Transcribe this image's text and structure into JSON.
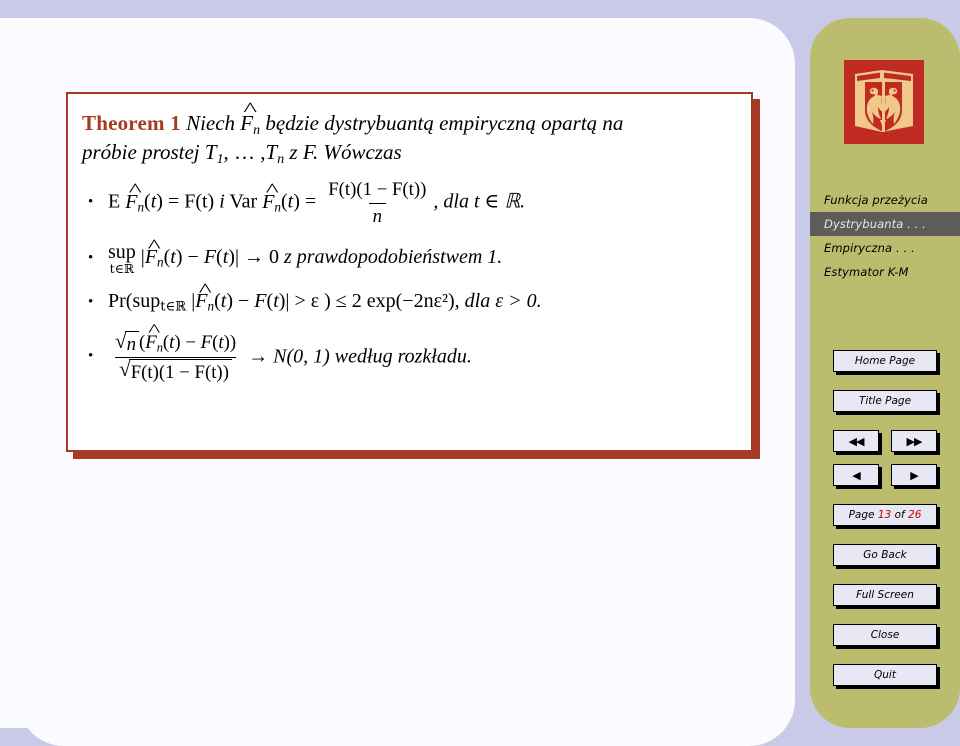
{
  "colors": {
    "background": "#c9c9e8",
    "slide_background": "#fbfaff",
    "theorem_border": "#a63a22",
    "theorem_label": "#a63a22",
    "nav_panel": "#bcbc6e",
    "nav_active": "#5c5c5c",
    "logo_red": "#bf2b21",
    "logo_tan": "#f0c88a",
    "button_face": "#e8e8f4",
    "page_number_red": "#c00000"
  },
  "slide": {
    "theorem": {
      "label": "Theorem 1",
      "statement_line1": "Niech",
      "statement_F": "F",
      "statement_n": "n",
      "statement_line1b": "będzie dystrybuantą empiryczną opartą na",
      "statement_line2a": "próbie prostej",
      "statement_T": "T",
      "statement_T1sub": "1",
      "statement_dots": ", … ,",
      "statement_Tn": "T",
      "statement_Tnsub": "n",
      "statement_line2b": "z",
      "statement_Fcap": "F.",
      "statement_line2c": "Wówczas",
      "bullets": [
        {
          "id": "bullet-expectation-variance",
          "text": "E F̂ₙ(t) = F(t) i Var F̂ₙ(t) = F(t)(1 − F(t)) / n, dla t ∈ ℝ.",
          "parts": {
            "E": "E",
            "eq_Ft": "= F(t)",
            "i": "i",
            "Var": "Var",
            "eq": "=",
            "numerator": "F(t)(1 − F(t))",
            "denominator": "n",
            "tail": ", dla t ∈ ℝ."
          }
        },
        {
          "id": "bullet-sup-convergence",
          "text": "sup_{t∈ℝ} |F̂ₙ(t) − F(t)| → 0 z prawdopodobieństwem 1.",
          "parts": {
            "sup": "sup",
            "sub": "t∈ℝ",
            "body": "| F̂ₙ(t) − F(t) |",
            "arrow": "→",
            "zero": "0",
            "tail": "z prawdopodobieństwem 1."
          }
        },
        {
          "id": "bullet-dkw-inequality",
          "text": "Pr( sup_{t∈ℝ} |F̂ₙ(t) − F(t)| > ε ) ≤ 2 exp(−2nε²), dla ε > 0.",
          "parts": {
            "pr_open": "Pr(",
            "sup": "sup",
            "sub": "t∈ℝ",
            "gt_eps": "> ε )",
            "leq": "≤",
            "bound": "2 exp(−2nε²)",
            "tail": ", dla ε > 0."
          }
        },
        {
          "id": "bullet-clt",
          "text": "√n(F̂ₙ(t) − F(t)) / √(F(t)(1 − F(t))) → N(0,1) według rozkładu.",
          "parts": {
            "num_sqrt": "n",
            "num_rest": "(F̂ₙ(t) − F(t))",
            "den_inner": "F(t)(1 − F(t))",
            "arrow": "→",
            "limit": "N(0, 1)",
            "tail": "według rozkładu."
          }
        }
      ]
    }
  },
  "nav": {
    "logo_name": "wroclaw-university-eagle-logo",
    "links": [
      {
        "label": "Funkcja przeżycia",
        "active": false,
        "name": "nav-link-funkcja-przezycia"
      },
      {
        "label": "Dystrybuanta . . .",
        "active": true,
        "name": "nav-link-dystrybuanta"
      },
      {
        "label": "Empiryczna . . .",
        "active": false,
        "name": "nav-link-empiryczna"
      },
      {
        "label": "Estymator K-M",
        "active": false,
        "name": "nav-link-estymator-km"
      }
    ],
    "buttons": {
      "home_page": "Home Page",
      "title_page": "Title Page",
      "fast_back": "◀◀",
      "fast_forward": "▶▶",
      "prev": "◀",
      "next": "▶",
      "page_prefix": "Page",
      "page_current": "13",
      "page_of": "of",
      "page_total": "26",
      "go_back": "Go Back",
      "full_screen": "Full Screen",
      "close": "Close",
      "quit": "Quit"
    }
  }
}
